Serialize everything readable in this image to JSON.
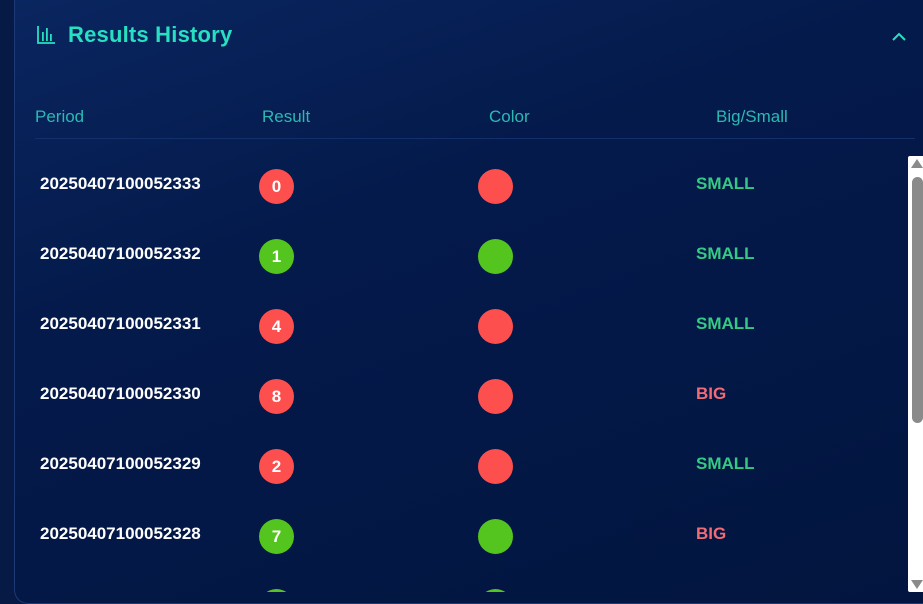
{
  "panel": {
    "title": "Results History",
    "icon": "bar-chart-icon",
    "collapse_icon": "chevron-up-icon"
  },
  "columns": [
    "Period",
    "Result",
    "Color",
    "Big/Small"
  ],
  "colors": {
    "red": "#fe4f4f",
    "green": "#54c51e",
    "accent": "#27dfc1",
    "small_text": "#36c985",
    "big_text": "#f16b76"
  },
  "rows": [
    {
      "period": "20250407100052333",
      "result": "0",
      "color": "red",
      "size": "SMALL"
    },
    {
      "period": "20250407100052332",
      "result": "1",
      "color": "green",
      "size": "SMALL"
    },
    {
      "period": "20250407100052331",
      "result": "4",
      "color": "red",
      "size": "SMALL"
    },
    {
      "period": "20250407100052330",
      "result": "8",
      "color": "red",
      "size": "BIG"
    },
    {
      "period": "20250407100052329",
      "result": "2",
      "color": "red",
      "size": "SMALL"
    },
    {
      "period": "20250407100052328",
      "result": "7",
      "color": "green",
      "size": "BIG"
    },
    {
      "period": "",
      "result": "",
      "color": "green",
      "size": ""
    }
  ]
}
